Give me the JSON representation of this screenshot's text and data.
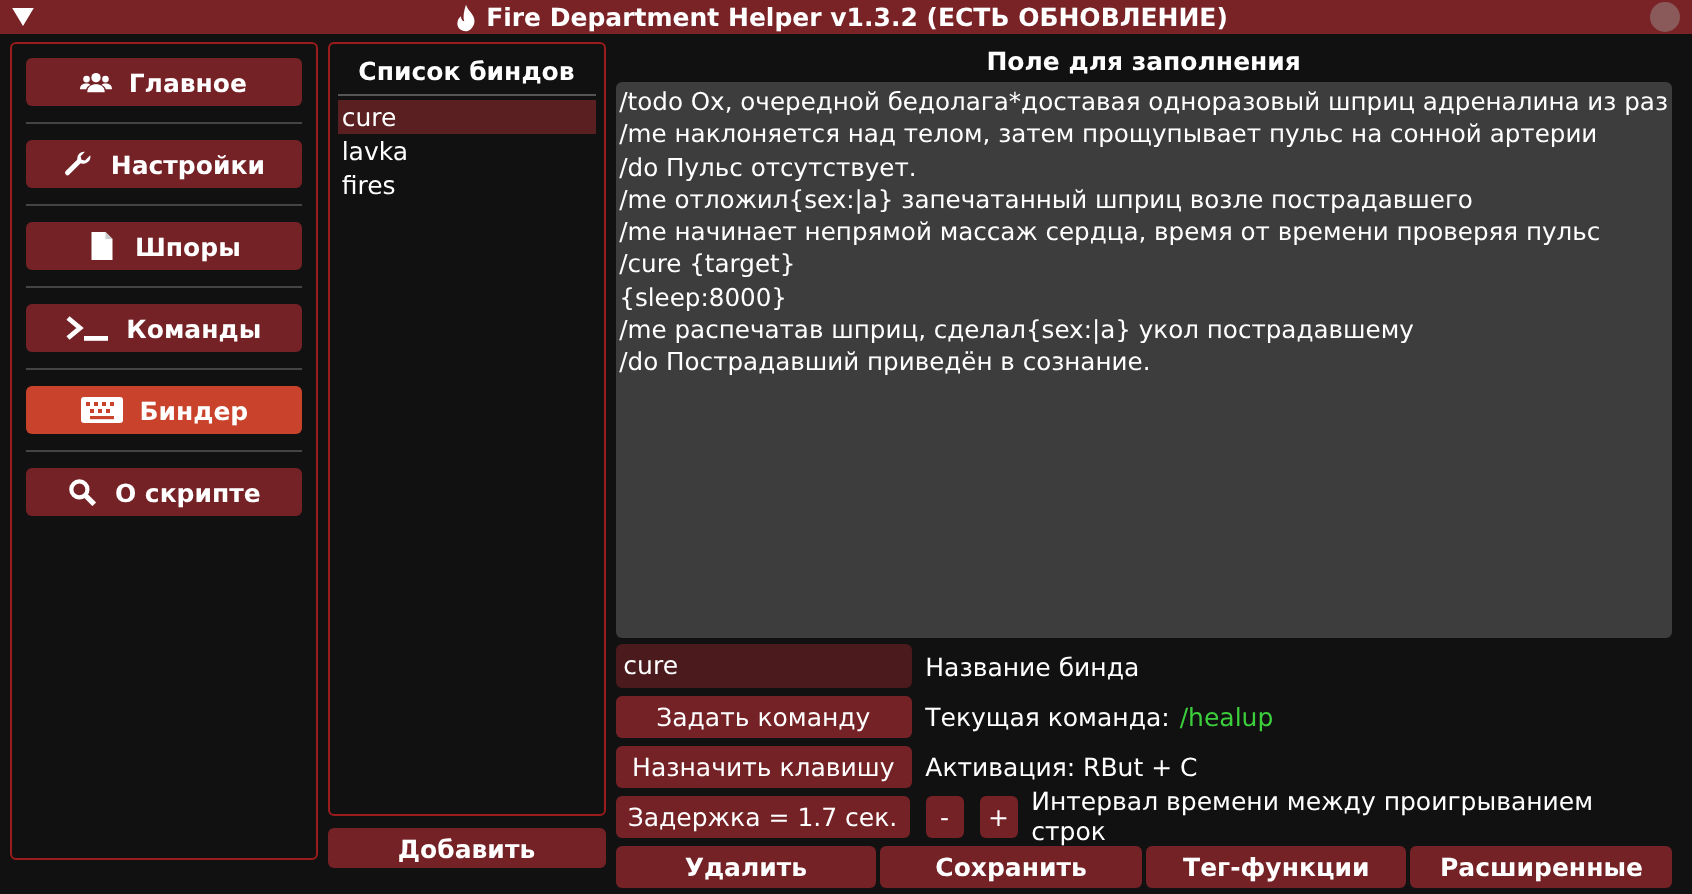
{
  "window": {
    "title": "Fire Department Helper v1.3.2 (ЕСТЬ ОБНОВЛЕНИЕ)"
  },
  "sidebar": {
    "items": [
      {
        "label": "Главное",
        "selected": false
      },
      {
        "label": "Настройки",
        "selected": false
      },
      {
        "label": "Шпоры",
        "selected": false
      },
      {
        "label": "Команды",
        "selected": false
      },
      {
        "label": "Биндер",
        "selected": true
      },
      {
        "label": "О скрипте",
        "selected": false
      }
    ]
  },
  "bind_list": {
    "title": "Список биндов",
    "items": [
      {
        "label": "cure",
        "selected": true
      },
      {
        "label": "lavka",
        "selected": false
      },
      {
        "label": "fires",
        "selected": false
      }
    ],
    "add_button": "Добавить"
  },
  "editor": {
    "title": "Поле для заполнения",
    "lines": [
      "/todo Ox, очередной бедолага*доставая одноразовый шприц адреналина из раз",
      "/me наклоняется над телом, затем прощупывает пульс на сонной артерии",
      "/do Пульс отсутствует.",
      "/me отложил{sex:|а} запечатанный шприц возле пострадавшего",
      "/me начинает непрямой массаж сердца, время от времени проверяя пульс",
      "/cure {target}",
      "{sleep:8000}",
      "/me распечатав шприц, сделал{sex:|а} укол пострадавшему",
      "/do Пострадавший приведён в сознание."
    ]
  },
  "name_field": {
    "value": "cure",
    "label": "Название бинда"
  },
  "command": {
    "button": "Задать команду",
    "label": "Текущая команда:",
    "value": "/healup"
  },
  "hotkey": {
    "button": "Назначить клавишу",
    "label": "Активация: RBut + C"
  },
  "delay": {
    "button": "Задержка = 1.7 сек.",
    "minus": "-",
    "plus": "+",
    "label": "Интервал времени между проигрыванием строк"
  },
  "actions": [
    "Удалить",
    "Сохранить",
    "Тег-функции",
    "Расширенные"
  ]
}
